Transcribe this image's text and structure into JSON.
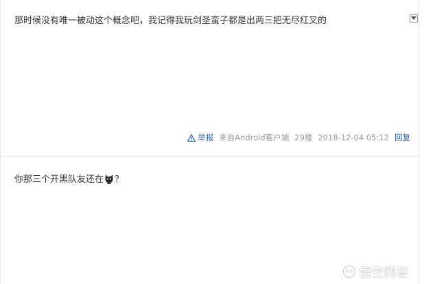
{
  "posts": [
    {
      "text": "那时候没有唯一被动这个概念吧，我记得我玩剑圣蛮子都是出两三把无尽红叉的",
      "meta": {
        "report_label": "举报",
        "source": "来自Android客户端",
        "floor": "29楼",
        "timestamp": "2018-12-04 05:12",
        "reply_label": "回复"
      }
    },
    {
      "text_before": "你那三个开黑队友还在",
      "text_after": "？",
      "emoji_icon": "black-cat-emoji-icon"
    }
  ],
  "watermark": {
    "text": "悟空问答",
    "icon": "wukong-logo-icon"
  },
  "colors": {
    "link": "#2d64b3",
    "meta_gray": "#999999",
    "body_text": "#333333",
    "divider": "#e6e6e6"
  }
}
